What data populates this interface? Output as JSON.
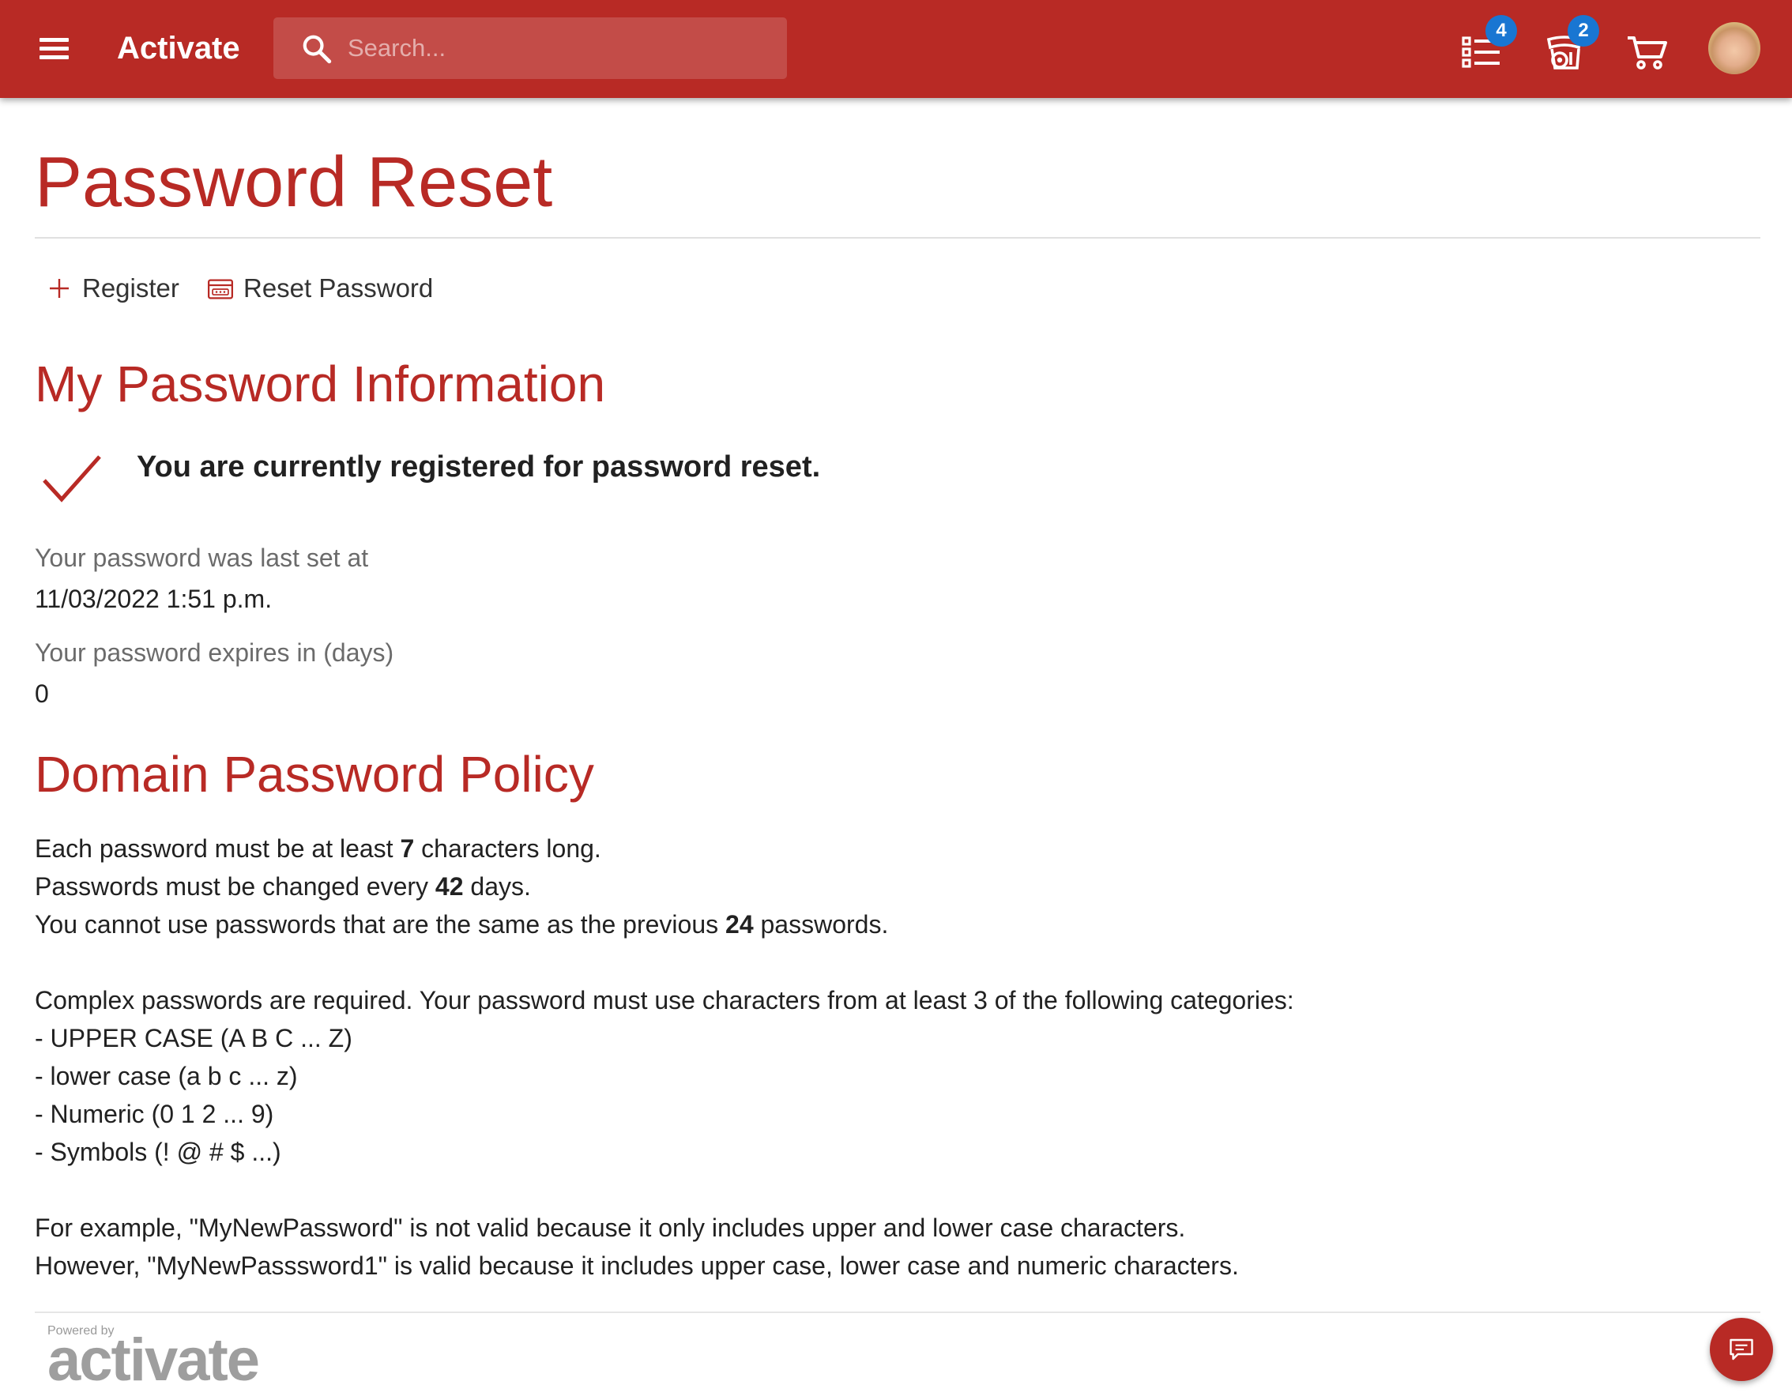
{
  "header": {
    "brand": "Activate",
    "search_placeholder": "Search...",
    "tasks_badge": "4",
    "requests_badge": "2",
    "icons": {
      "menu": "hamburger-menu-icon",
      "search": "search-icon",
      "tasks": "task-list-icon",
      "requests": "bell-requests-icon",
      "cart": "shopping-cart-icon",
      "user": "user-avatar"
    },
    "accent_color": "#b82a25",
    "badge_color": "#1976d2"
  },
  "page": {
    "title": "Password Reset"
  },
  "actions": {
    "register_label": "Register",
    "reset_label": "Reset Password"
  },
  "password_info": {
    "heading": "My Password Information",
    "status": "You are currently registered for password reset.",
    "last_set_label": "Your password was last set at",
    "last_set_value": "11/03/2022 1:51 p.m.",
    "expires_label": "Your password expires in (days)",
    "expires_value": "0"
  },
  "policy": {
    "heading": "Domain Password Policy",
    "min_length": {
      "pre": "Each password must be at least ",
      "value": "7",
      "post": " characters long."
    },
    "change_every": {
      "pre": "Passwords must be changed every ",
      "value": "42",
      "post": " days."
    },
    "history": {
      "pre": "You cannot use passwords that are the same as the previous ",
      "value": "24",
      "post": " passwords."
    },
    "complexity_intro": "Complex passwords are required. Your password must use characters from at least 3 of the following categories:",
    "categories": [
      "- UPPER CASE (A B C ... Z)",
      "- lower case (a b c ... z)",
      "- Numeric (0 1 2 ... 9)",
      "- Symbols (! @ # $ ...)"
    ],
    "example_invalid": "For example, \"MyNewPassword\" is not valid because it only includes upper and lower case characters.",
    "example_valid": "However, \"MyNewPasssword1\" is valid because it includes upper case, lower case and numeric characters."
  },
  "footer": {
    "powered_by": "Powered by",
    "logo_text": "activate",
    "chat_icon": "chat-bubble-icon"
  }
}
